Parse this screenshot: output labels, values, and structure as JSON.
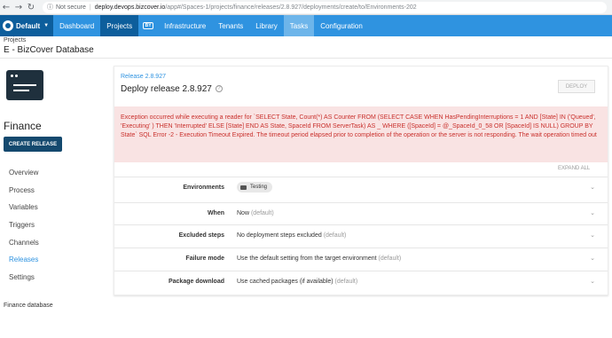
{
  "browser": {
    "back_icon": "arrow-left-icon",
    "forward_icon": "arrow-right-icon",
    "reload_icon": "reload-icon",
    "security_icon": "info-icon",
    "security_label": "Not secure",
    "url_host": "deploy.devops.bizcover.io",
    "url_path": "/app#/Spaces-1/projects/finance/releases/2.8.927/deployments/create/to/Environments-202"
  },
  "app_nav": {
    "space_label": "Default",
    "items": [
      {
        "label": "Dashboard"
      },
      {
        "label": "Projects"
      },
      {
        "label": "Infrastructure"
      },
      {
        "label": "Tenants"
      },
      {
        "label": "Library"
      },
      {
        "label": "Tasks"
      },
      {
        "label": "Configuration"
      }
    ],
    "active_color": "#0d5e9c",
    "bar_color": "#2f93e0"
  },
  "breadcrumb": {
    "parent": "Projects",
    "title": "E - BizCover Database"
  },
  "sidebar": {
    "project_name": "Finance",
    "create_release_label": "CREATE RELEASE",
    "links": [
      {
        "label": "Overview"
      },
      {
        "label": "Process"
      },
      {
        "label": "Variables"
      },
      {
        "label": "Triggers"
      },
      {
        "label": "Channels"
      },
      {
        "label": "Releases"
      },
      {
        "label": "Settings"
      }
    ],
    "active_link": "Releases",
    "footer": "Finance database"
  },
  "main": {
    "release_link": "Release 2.8.927",
    "title": "Deploy release 2.8.927",
    "deploy_label": "DEPLOY",
    "error_message": "Exception occurred while executing a reader for `SELECT State, Count(*) AS Counter FROM (SELECT CASE WHEN HasPendingInterruptions = 1 AND [State] IN ('Queued', 'Executing' ) THEN 'Interrupted' ELSE [State] END AS State, SpaceId FROM ServerTask) AS _ WHERE ([SpaceId] = @_SpaceId_0_58 OR [SpaceId] IS NULL) GROUP BY State` SQL Error -2 - Execution Timeout Expired. The timeout period elapsed prior to completion of the operation or the server is not responding. The wait operation timed out",
    "error_color": "#c9302c",
    "expand_all_label": "EXPAND ALL",
    "options": [
      {
        "label": "Environments",
        "value": "Testing",
        "muted": ""
      },
      {
        "label": "When",
        "value": "Now",
        "muted": "(default)"
      },
      {
        "label": "Excluded steps",
        "value": "No deployment steps excluded",
        "muted": "(default)"
      },
      {
        "label": "Failure mode",
        "value": "Use the default setting from the target environment",
        "muted": "(default)"
      },
      {
        "label": "Package download",
        "value": "Use cached packages (if available)",
        "muted": "(default)"
      }
    ]
  }
}
